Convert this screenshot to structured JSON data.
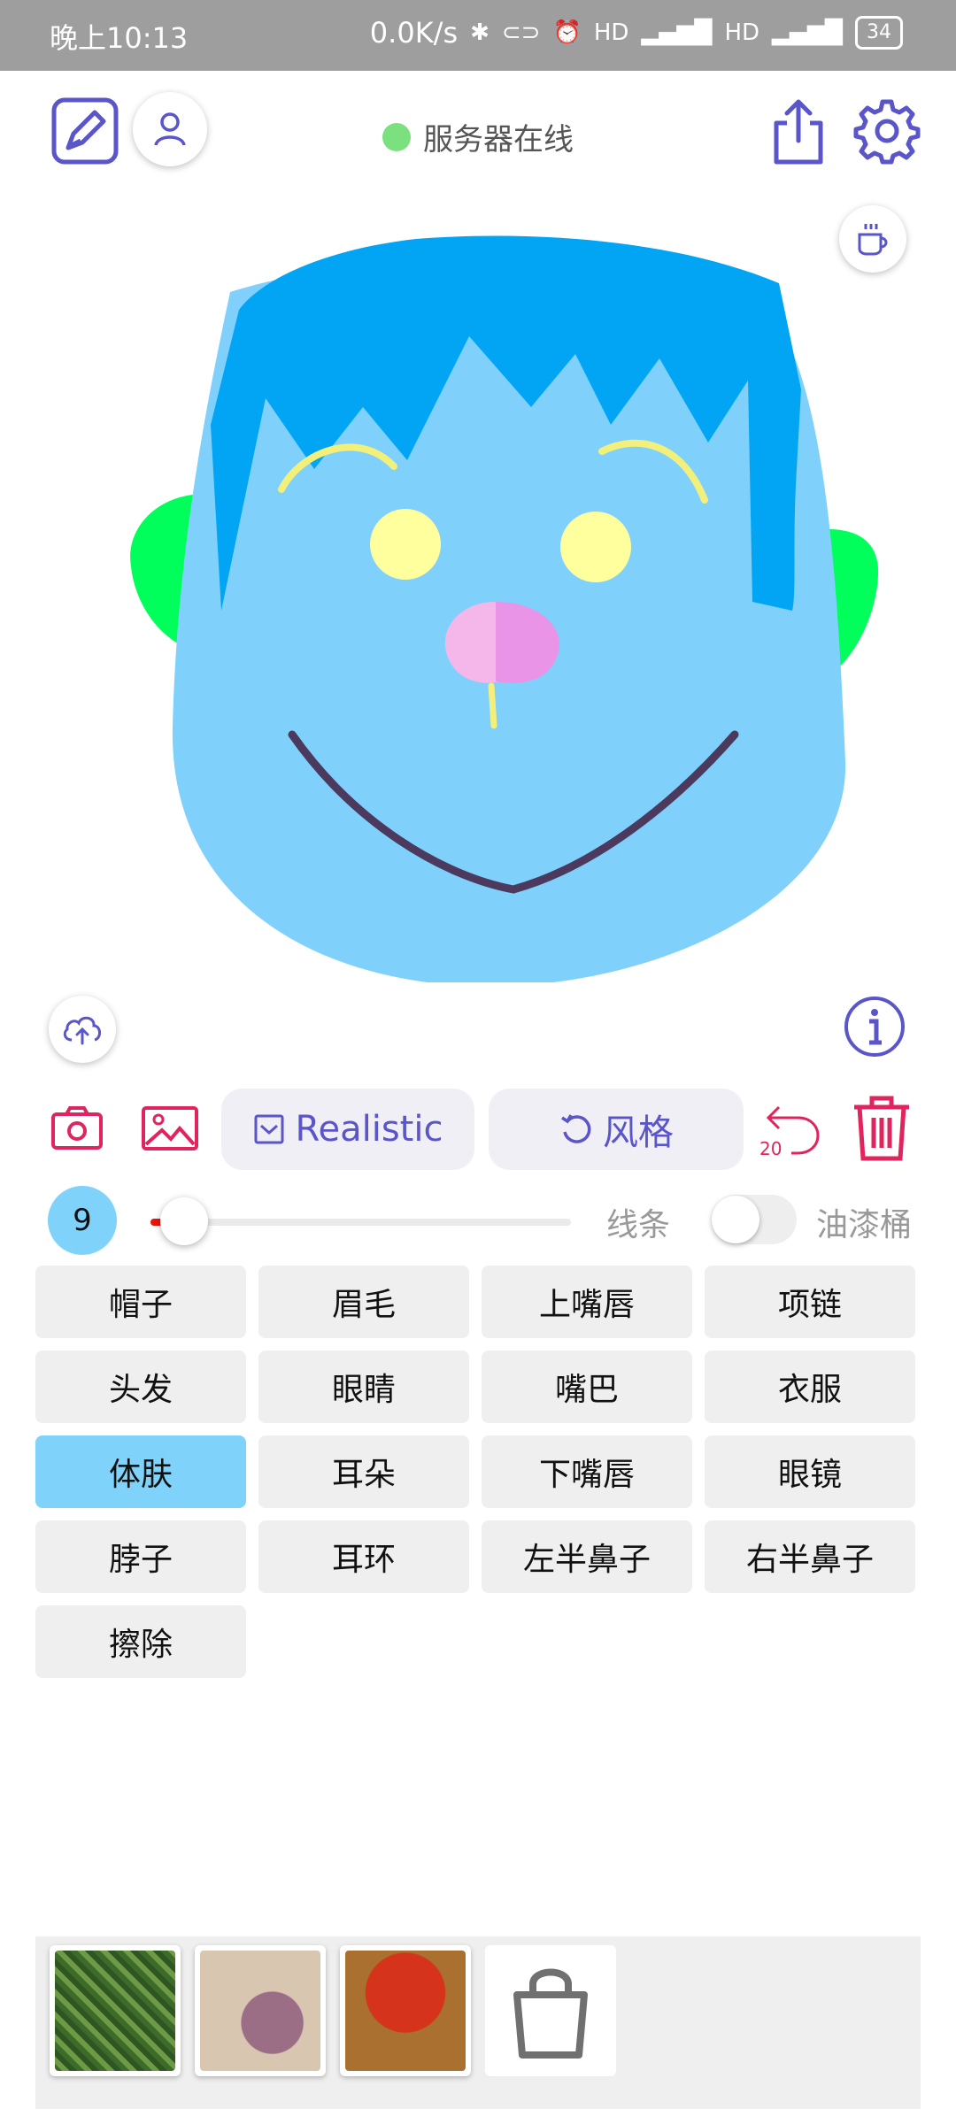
{
  "status_bar": {
    "time": "晚上10:13",
    "network_speed": "0.0K/s",
    "battery": "34",
    "icons": [
      "bluetooth-icon",
      "vpn-icon",
      "alarm-icon",
      "hd-icon",
      "4g-signal-icon",
      "hd-icon",
      "4g-signal-icon",
      "battery-icon"
    ]
  },
  "top_bar": {
    "server_status": "服务器在线",
    "server_status_color": "#7be07e",
    "icons": [
      "edit-icon",
      "user-icon",
      "share-icon",
      "settings-icon"
    ]
  },
  "canvas": {
    "coffee_icon": "coffee-icon",
    "upload_icon": "cloud-upload-icon",
    "info_icon": "info-icon"
  },
  "controls": {
    "camera_icon": "camera-icon",
    "gallery_icon": "image-icon",
    "realistic_label": "Realistic",
    "style_label": "风格",
    "undo_count": "20",
    "accent_color": "#e0245e",
    "pill_text_color": "#5a55c8"
  },
  "brush": {
    "size": "9",
    "slider_value": 0.08,
    "line_label": "线条",
    "bucket_label": "油漆桶",
    "bucket_enabled": false
  },
  "parts": [
    {
      "label": "帽子",
      "active": false
    },
    {
      "label": "眉毛",
      "active": false
    },
    {
      "label": "上嘴唇",
      "active": false
    },
    {
      "label": "项链",
      "active": false
    },
    {
      "label": "头发",
      "active": false
    },
    {
      "label": "眼睛",
      "active": false
    },
    {
      "label": "嘴巴",
      "active": false
    },
    {
      "label": "衣服",
      "active": false
    },
    {
      "label": "体肤",
      "active": true
    },
    {
      "label": "耳朵",
      "active": false
    },
    {
      "label": "下嘴唇",
      "active": false
    },
    {
      "label": "眼镜",
      "active": false
    },
    {
      "label": "脖子",
      "active": false
    },
    {
      "label": "耳环",
      "active": false
    },
    {
      "label": "左半鼻子",
      "active": false
    },
    {
      "label": "右半鼻子",
      "active": false
    },
    {
      "label": "擦除",
      "active": false
    }
  ],
  "tray": {
    "thumbnails": [
      "thumbnail-green-texture",
      "thumbnail-beige-texture",
      "thumbnail-red-texture"
    ],
    "bag_icon": "shopping-bag-icon"
  }
}
